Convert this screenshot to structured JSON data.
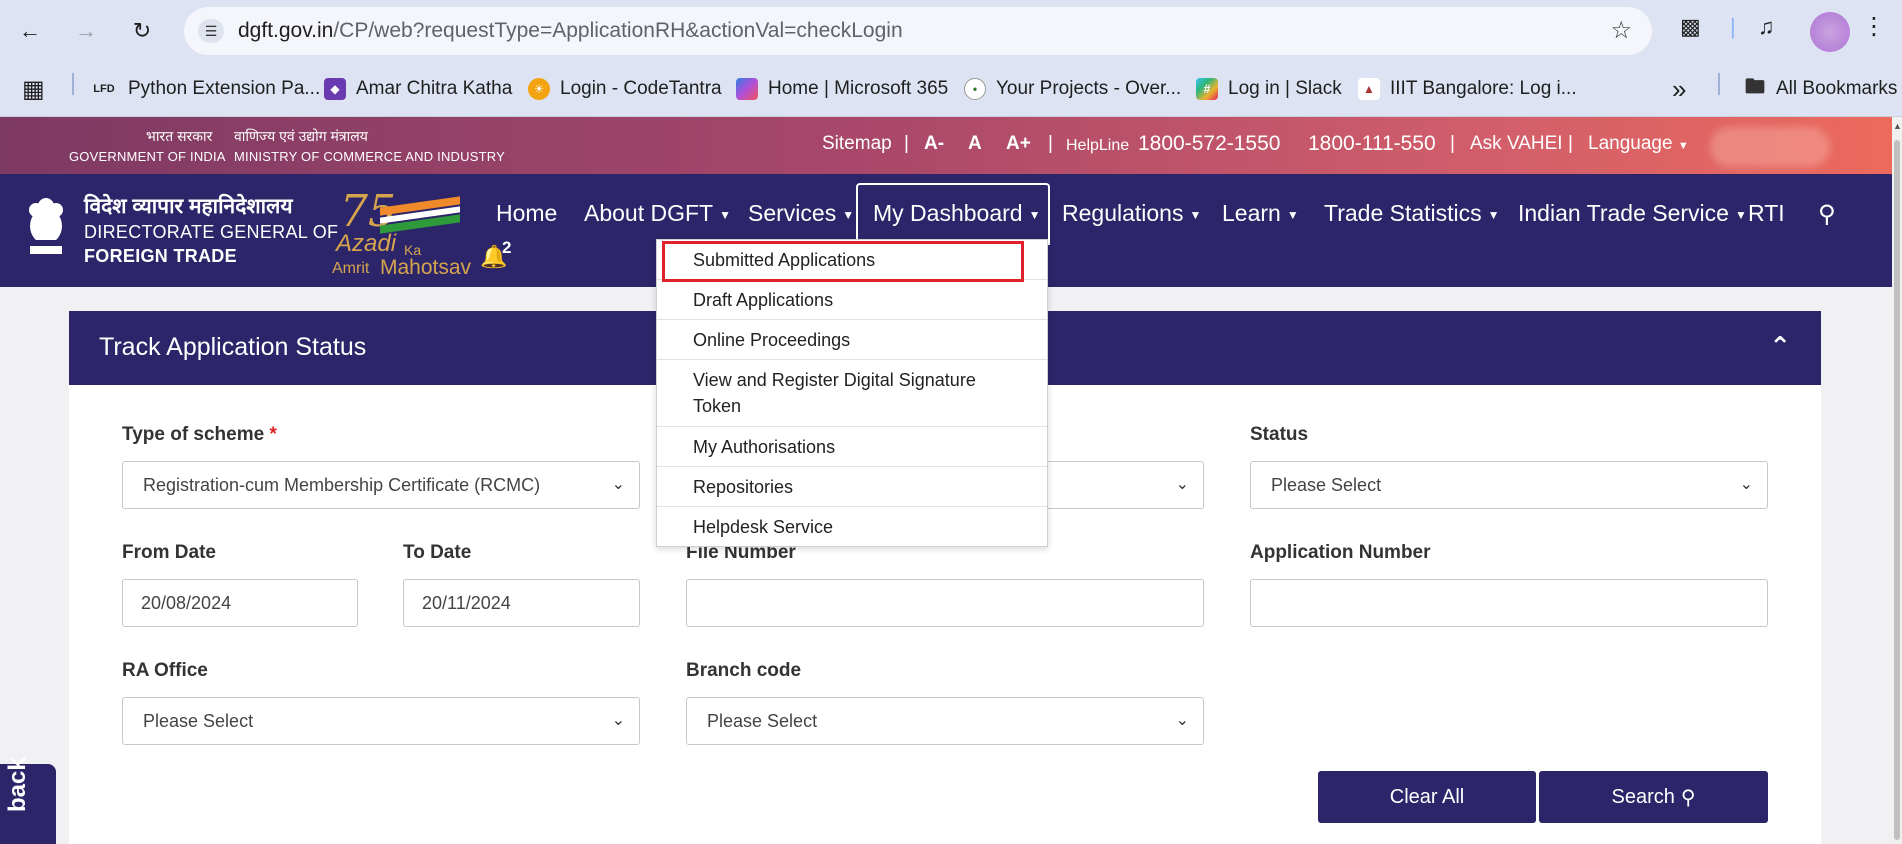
{
  "browser": {
    "url_domain": "dgft.gov.in",
    "url_path": "/CP/web?requestType=ApplicationRH&actionVal=checkLogin",
    "bookmarks": [
      {
        "label": "Python Extension Pa...",
        "icon": "lfd-icon",
        "badge": "LFD"
      },
      {
        "label": "Amar Chitra Katha",
        "icon": "amar-chitra-katha-icon"
      },
      {
        "label": "Login - CodeTantra",
        "icon": "codetantra-icon"
      },
      {
        "label": "Home | Microsoft 365",
        "icon": "microsoft365-icon"
      },
      {
        "label": "Your Projects - Over...",
        "icon": "overleaf-icon"
      },
      {
        "label": "Log in | Slack",
        "icon": "slack-icon"
      },
      {
        "label": "IIIT Bangalore: Log i...",
        "icon": "iiitb-icon"
      }
    ],
    "more_bookmarks": "»",
    "all_bookmarks": "All Bookmarks"
  },
  "gov_strip": {
    "hi_gov": "भारत सरकार",
    "en_gov": "GOVERNMENT OF INDIA",
    "hi_ministry": "वाणिज्य एवं उद्योग मंत्रालय",
    "en_ministry": "MINISTRY OF COMMERCE AND INDUSTRY",
    "sitemap": "Sitemap",
    "font_small": "A-",
    "font_normal": "A",
    "font_large": "A+",
    "helpline_label": "HelpLine",
    "helpline_1": "1800-572-1550",
    "helpline_2": "1800-111-550",
    "ask_vahei": "Ask VAHEI",
    "language": "Language",
    "sep": "|"
  },
  "header": {
    "dg_hi": "विदेश व्यापार महानिदेशालय",
    "dg_en_1": "DIRECTORATE GENERAL OF",
    "dg_en_2": "FOREIGN TRADE",
    "azadi_75": "75",
    "azadi_1": "Azadi",
    "azadi_ka": "Ka",
    "azadi_2": "Amrit",
    "azadi_3": "Mahotsav",
    "bell_count": "2",
    "nav": [
      "Home",
      "About DGFT",
      "Services",
      "My Dashboard",
      "Regulations",
      "Learn",
      "Trade Statistics",
      "Indian Trade Service",
      "RTI"
    ]
  },
  "dropdown": {
    "items": [
      "Submitted Applications",
      "Draft Applications",
      "Online Proceedings",
      "View and Register Digital Signature Token",
      "My Authorisations",
      "Repositories",
      "Helpdesk Service"
    ]
  },
  "form": {
    "title": "Track Application Status",
    "type_of_scheme_label": "Type of scheme",
    "required_mark": "*",
    "type_of_scheme_value": "Registration-cum Membership Certificate (RCMC)",
    "status_label": "Status",
    "status_value": "Please Select",
    "from_date_label": "From Date",
    "from_date_value": "20/08/2024",
    "to_date_label": "To Date",
    "to_date_value": "20/11/2024",
    "file_number_label": "File Number",
    "application_number_label": "Application Number",
    "ra_office_label": "RA Office",
    "ra_office_value": "Please Select",
    "branch_code_label": "Branch code",
    "branch_code_value": "Please Select",
    "clear_all": "Clear All",
    "search": "Search"
  },
  "feedback_tab": "back",
  "colors": {
    "nav_bg": "#2c2569",
    "strip_start": "#7d3a63",
    "strip_end": "#ec6a5c",
    "highlight": "#e0202a"
  }
}
